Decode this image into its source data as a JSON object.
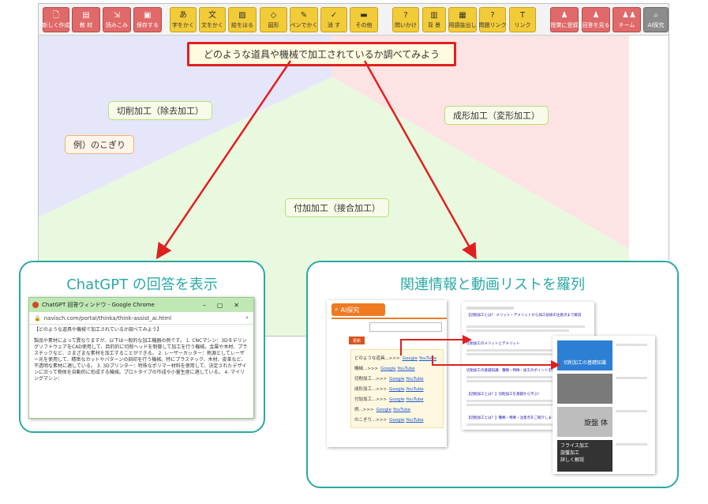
{
  "toolbar": {
    "buttons": [
      {
        "label": "新しく作成",
        "icon": "new-file-icon",
        "color": "red"
      },
      {
        "label": "教 材",
        "icon": "book-icon",
        "color": "red"
      },
      {
        "label": "読みこみ",
        "icon": "import-icon",
        "color": "red"
      },
      {
        "label": "保存する",
        "icon": "save-icon",
        "color": "red"
      },
      {
        "label": "字をかく",
        "icon": "text-icon",
        "color": "yellow"
      },
      {
        "label": "文をかく",
        "icon": "sentence-icon",
        "color": "yellow"
      },
      {
        "label": "絵をはる",
        "icon": "image-icon",
        "color": "yellow"
      },
      {
        "label": "図形",
        "icon": "shape-icon",
        "color": "yellow"
      },
      {
        "label": "ペンでかく",
        "icon": "pen-icon",
        "color": "yellow"
      },
      {
        "label": "消 す",
        "icon": "eraser-icon",
        "color": "yellow"
      },
      {
        "label": "その他",
        "icon": "toolbox-icon",
        "color": "yellow"
      },
      {
        "label": "問いかけ",
        "icon": "question-icon",
        "color": "yellow"
      },
      {
        "label": "背 景",
        "icon": "background-icon",
        "color": "yellow"
      },
      {
        "label": "用語抜出し",
        "icon": "terms-icon",
        "color": "yellow"
      },
      {
        "label": "問題リンク",
        "icon": "question-link-icon",
        "color": "yellow"
      },
      {
        "label": "リンク",
        "icon": "link-icon",
        "color": "yellow"
      },
      {
        "label": "授業に登録",
        "icon": "register-icon",
        "color": "red"
      },
      {
        "label": "回答を見る",
        "icon": "answers-icon",
        "color": "red"
      },
      {
        "label": "チーム",
        "icon": "team-icon",
        "color": "red"
      },
      {
        "label": "AI探究",
        "icon": "ai-search-icon",
        "color": "gray"
      }
    ]
  },
  "canvas": {
    "main_question": "どのような道具や機械で加工されているか調べてみよう",
    "regions": [
      "#e6e6fa",
      "#fde3e3",
      "#e6f8dc"
    ],
    "nodes": {
      "cutting": "切削加工（除去加工）",
      "example": "例）のこぎり",
      "forming": "成形加工（変形加工）",
      "joining": "付加加工（接合加工）"
    }
  },
  "left_card": {
    "title": "ChatGPT の回答を表示",
    "window": {
      "title": "ChatGPT 回答ウィンドウ - Google Chrome",
      "url": "navisch.com/portal/thinka/think-assist_ai.html",
      "question": "【どのような道具や機械で加工されているか調べてみよう】",
      "answer": "製品や素材によって異なりますが、以下は一般的な加工機器の例です。 1. CNCマシン：3DモデリングソフトウェアをCAD使用して、目的的に切削ヘッドを制御して加工を行う機械。金属や木材、プラスチックなど、さまざまな素材を加工することができる。 2. レーザーカッター：熱源としてレーザー光を使用して、精密なカットやパターンの刻印を行う機械。特にプラスチック、木材、皮革など、不透明な素材に適している。 3. 3Dプリンター：特殊なポリマー材料を使用して、決定されたデザインに沿って物体を自動的に形成する機械。プロトタイプの作成や小量生産に適している。 4. マイリングマシン："
    }
  },
  "right_card": {
    "title": "関連情報と動画リストを羅列",
    "ai_panel": {
      "header": "AI探究",
      "update_button": "更新",
      "rows": [
        {
          "term": "どのような道具...>>>",
          "g": "Google",
          "y": "YouTube"
        },
        {
          "term": "機械...>>>",
          "g": "Google",
          "y": "YouTube"
        },
        {
          "term": "切削加工...>>>",
          "g": "Google",
          "y": "YouTube"
        },
        {
          "term": "成形加工...>>>",
          "g": "Google",
          "y": "YouTube"
        },
        {
          "term": "付加加工...>>>",
          "g": "Google",
          "y": "YouTube"
        },
        {
          "term": "例...>>>",
          "g": "Google",
          "y": "YouTube"
        },
        {
          "term": "のこぎり...>>>",
          "g": "Google",
          "y": "YouTube"
        }
      ]
    },
    "search_results": {
      "r1": "【切削加工とは？ メリット・デメリットから加工技術の注意点まで解説",
      "r2": "切削加工のメリットとデメリット",
      "r3": "切削加工の基礎知識：種類・特徴・加工のポイントを解説",
      "r4": "【切削加工とは？】切削加工を基礎から学ぶ！",
      "r5": "【切削加工とは？】種類・特徴・注意点をご紹介します"
    },
    "video_results": {
      "v1_caption": "切削加工の基礎知識",
      "v2_text": "旋盤 体",
      "v3_line1": "フライス加工",
      "v3_line2": "旋盤加工",
      "v3_line3": "詳しく解説"
    }
  }
}
